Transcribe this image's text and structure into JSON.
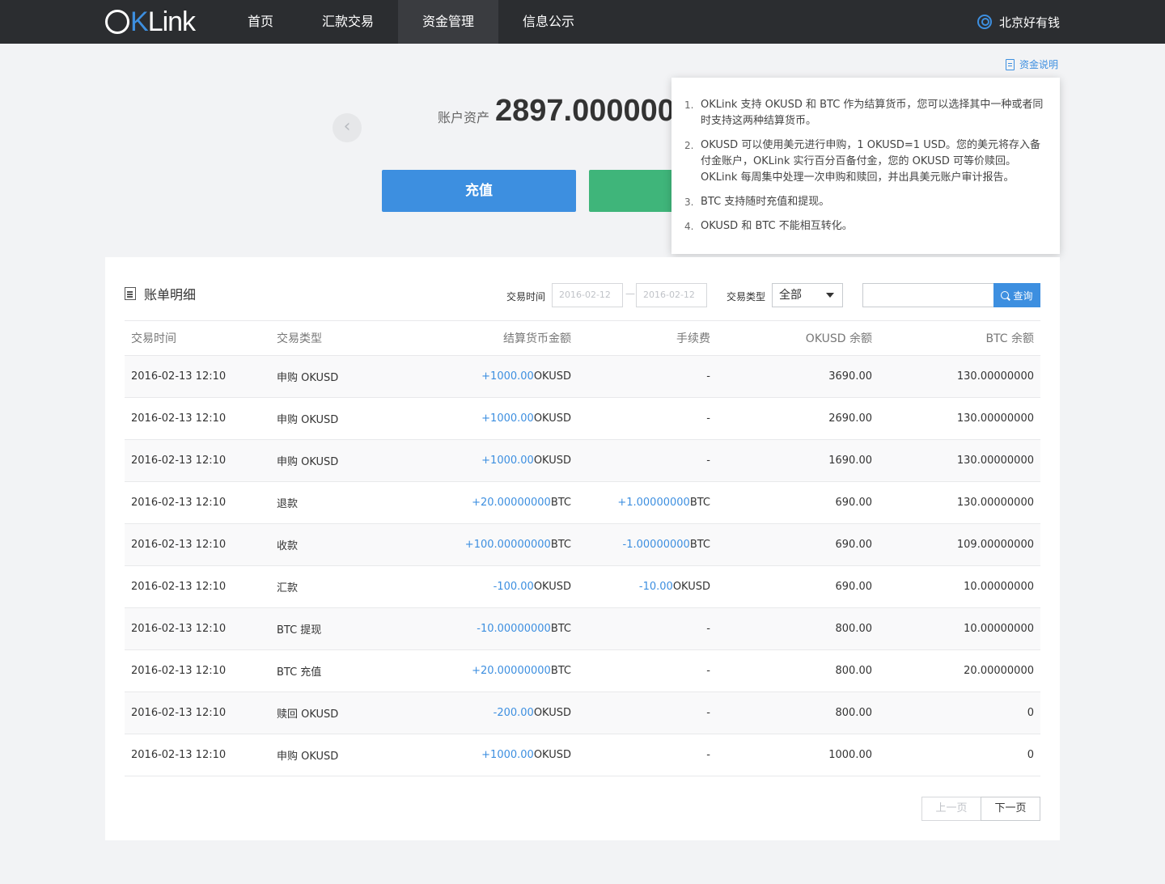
{
  "nav": {
    "logo": "OKLink",
    "items": [
      {
        "label": "首页"
      },
      {
        "label": "汇款交易"
      },
      {
        "label": "资金管理"
      },
      {
        "label": "信息公示"
      }
    ],
    "user": "北京好有钱"
  },
  "fund_link": "资金说明",
  "asset": {
    "label": "账户资产",
    "value": "2897.0000000"
  },
  "buttons": {
    "recharge": "充值"
  },
  "popup": {
    "items": [
      {
        "n": "1.",
        "text": "OKLink 支持 OKUSD 和 BTC 作为结算货币，您可以选择其中一种或者同时支持这两种结算货币。"
      },
      {
        "n": "2.",
        "text": "OKUSD 可以使用美元进行申购，1 OKUSD=1 USD。您的美元将存入备付金账户，OKLink 实行百分百备付金，您的 OKUSD 可等价赎回。OKLink 每周集中处理一次申购和赎回，并出具美元账户审计报告。"
      },
      {
        "n": "3.",
        "text": "BTC 支持随时充值和提现。"
      },
      {
        "n": "4.",
        "text": "OKUSD 和 BTC 不能相互转化。"
      }
    ]
  },
  "bill": {
    "title": "账单明细",
    "filter": {
      "time_label": "交易时间",
      "date_from": "2016-02-12",
      "date_to": "2016-02-12",
      "date_sep": "—",
      "type_label": "交易类型",
      "type_value": "全部",
      "search_button": "查询"
    },
    "columns": [
      "交易时间",
      "交易类型",
      "结算货币金额",
      "手续费",
      "OKUSD 余额",
      "BTC 余额"
    ],
    "rows": [
      {
        "time": "2016-02-13  12:10",
        "type": "申购 OKUSD",
        "amount": "+1000.00",
        "amount_unit": "OKUSD",
        "fee": "-",
        "fee_unit": "",
        "okusd": "3690.00",
        "btc": "130.00000000"
      },
      {
        "time": "2016-02-13  12:10",
        "type": "申购 OKUSD",
        "amount": "+1000.00",
        "amount_unit": "OKUSD",
        "fee": "-",
        "fee_unit": "",
        "okusd": "2690.00",
        "btc": "130.00000000"
      },
      {
        "time": "2016-02-13  12:10",
        "type": "申购 OKUSD",
        "amount": "+1000.00",
        "amount_unit": "OKUSD",
        "fee": "-",
        "fee_unit": "",
        "okusd": "1690.00",
        "btc": "130.00000000"
      },
      {
        "time": "2016-02-13  12:10",
        "type": "退款",
        "amount": "+20.00000000",
        "amount_unit": "BTC",
        "fee": "+1.00000000",
        "fee_unit": "BTC",
        "okusd": "690.00",
        "btc": "130.00000000"
      },
      {
        "time": "2016-02-13  12:10",
        "type": "收款",
        "amount": "+100.00000000",
        "amount_unit": "BTC",
        "fee": "-1.00000000",
        "fee_unit": "BTC",
        "okusd": "690.00",
        "btc": "109.00000000"
      },
      {
        "time": "2016-02-13  12:10",
        "type": "汇款",
        "amount": "-100.00",
        "amount_unit": "OKUSD",
        "fee": "-10.00",
        "fee_unit": "OKUSD",
        "okusd": "690.00",
        "btc": "10.00000000"
      },
      {
        "time": "2016-02-13  12:10",
        "type": "BTC 提现",
        "amount": "-10.00000000",
        "amount_unit": "BTC",
        "fee": "-",
        "fee_unit": "",
        "okusd": "800.00",
        "btc": "10.00000000"
      },
      {
        "time": "2016-02-13  12:10",
        "type": "BTC 充值",
        "amount": "+20.00000000",
        "amount_unit": "BTC",
        "fee": "-",
        "fee_unit": "",
        "okusd": "800.00",
        "btc": "20.00000000"
      },
      {
        "time": "2016-02-13  12:10",
        "type": "赎回 OKUSD",
        "amount": "-200.00",
        "amount_unit": "OKUSD",
        "fee": "-",
        "fee_unit": "",
        "okusd": "800.00",
        "btc": "0"
      },
      {
        "time": "2016-02-13  12:10",
        "type": "申购 OKUSD",
        "amount": "+1000.00",
        "amount_unit": "OKUSD",
        "fee": "-",
        "fee_unit": "",
        "okusd": "1000.00",
        "btc": "0"
      }
    ],
    "pager": {
      "prev": "上一页",
      "next": "下一页"
    }
  },
  "colors": {
    "nav_bg": "#2b2d30",
    "accent_blue": "#3d8fe0",
    "accent_green": "#3fb57a"
  }
}
